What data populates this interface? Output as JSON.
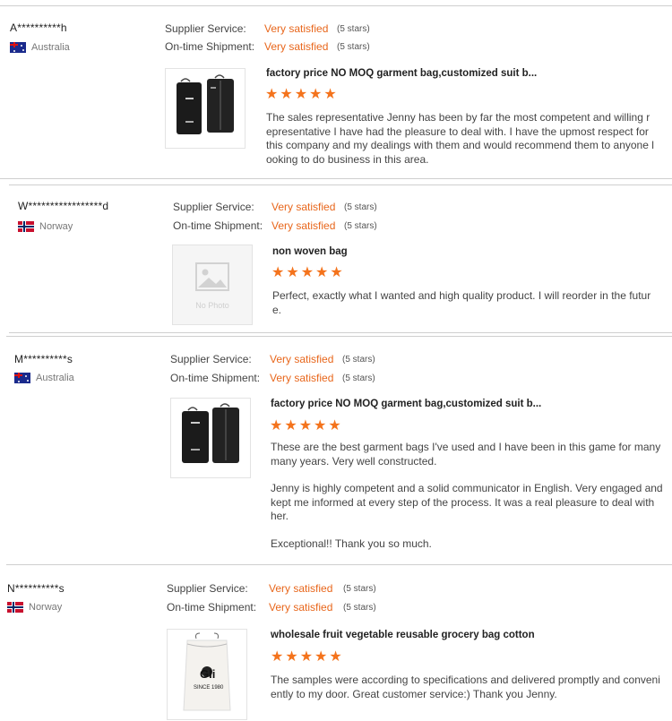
{
  "labels": {
    "supplier_service": "Supplier Service:",
    "ontime_shipment": "On-time Shipment:"
  },
  "reviews": [
    {
      "user": "A**********h",
      "country": "Australia",
      "supplier_rating": "Very satisfied",
      "supplier_stars": "(5 stars)",
      "shipment_rating": "Very satisfied",
      "shipment_stars": "(5 stars)",
      "product_title": "factory price NO MOQ garment bag,customized suit b...",
      "stars": 5,
      "paragraphs": [
        "The sales representative Jenny has been by far the most competent and willing representative I have had the pleasure to deal with. I have the upmost respect for this company and my dealings with them and would recommend them to anyone looking to do business in this area."
      ]
    },
    {
      "user": "W*****************d",
      "country": "Norway",
      "supplier_rating": "Very satisfied",
      "supplier_stars": "(5 stars)",
      "shipment_rating": "Very satisfied",
      "shipment_stars": "(5 stars)",
      "product_title": "non woven bag",
      "stars": 5,
      "no_photo_label": "No Photo",
      "paragraphs": [
        "Perfect, exactly what I wanted and high quality product. I will reorder in the future."
      ]
    },
    {
      "user": "M**********s",
      "country": "Australia",
      "supplier_rating": "Very satisfied",
      "supplier_stars": "(5 stars)",
      "shipment_rating": "Very satisfied",
      "shipment_stars": "(5 stars)",
      "product_title": "factory price NO MOQ garment bag,customized suit b...",
      "stars": 5,
      "paragraphs": [
        "These are the best garment bags I've used and I have been in this game for many many years. Very well constructed.",
        "Jenny is highly competent and a solid communicator in English. Very engaged and kept me informed at every step of the process. It was a real pleasure to deal with her.",
        "Exceptional!! Thank you so much."
      ]
    },
    {
      "user": "N**********s",
      "country": "Norway",
      "supplier_rating": "Very satisfied",
      "supplier_stars": "(5 stars)",
      "shipment_rating": "Very satisfied",
      "shipment_stars": "(5 stars)",
      "product_title": "wholesale fruit vegetable reusable grocery bag cotton",
      "stars": 5,
      "bag_logo": "Gli",
      "bag_text": "SINCE 1980",
      "paragraphs": [
        "The samples were according to specifications and delivered promptly and conveniently to my door. Great customer service:) Thank you Jenny."
      ]
    }
  ],
  "colors": {
    "accent": "#e8661b",
    "star": "#f4731c",
    "divider": "#cfcfcf"
  }
}
